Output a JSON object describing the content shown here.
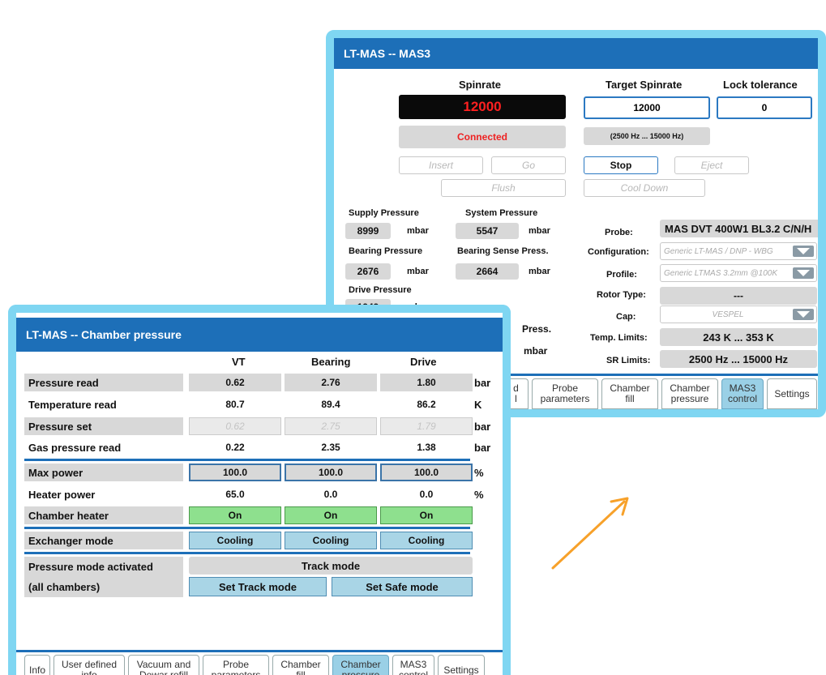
{
  "mas3": {
    "title": "LT-MAS -- MAS3",
    "spinrate_label": "Spinrate",
    "spinrate_value": "12000",
    "connection_status": "Connected",
    "target_label": "Target Spinrate",
    "target_value": "12000",
    "target_range": "(2500 Hz ... 15000 Hz)",
    "lock_label": "Lock tolerance",
    "lock_value": "0",
    "buttons": {
      "insert": "Insert",
      "go": "Go",
      "stop": "Stop",
      "eject": "Eject",
      "flush": "Flush",
      "cool_down": "Cool Down"
    },
    "pressures": {
      "supply_label": "Supply Pressure",
      "supply_value": "8999",
      "system_label": "System Pressure",
      "system_value": "5547",
      "bearing_label": "Bearing Pressure",
      "bearing_value": "2676",
      "bearing_sense_label": "Bearing Sense Press.",
      "bearing_sense_value": "2664",
      "drive_label": "Drive Pressure",
      "drive_value": "1949",
      "unit": "mbar",
      "partial_label": "Press.",
      "partial_unit": "mbar"
    },
    "probe": {
      "probe_label": "Probe:",
      "probe_value": "MAS DVT 400W1 BL3.2 C/N/H",
      "config_label": "Configuration:",
      "config_value": "Generic LT-MAS / DNP - WBG",
      "profile_label": "Profile:",
      "profile_value": "Generic LTMAS 3.2mm @100K",
      "rotor_label": "Rotor Type:",
      "rotor_value": "---",
      "cap_label": "Cap:",
      "cap_value": "VESPEL",
      "temp_label": "Temp. Limits:",
      "temp_value": "243 K ... 353 K",
      "sr_label": "SR Limits:",
      "sr_value": "2500 Hz ... 15000 Hz"
    },
    "tabs": [
      {
        "label": "d\nl"
      },
      {
        "label": "Probe\nparameters"
      },
      {
        "label": "Chamber\nfill"
      },
      {
        "label": "Chamber\npressure"
      },
      {
        "label": "MAS3\ncontrol",
        "active": true
      },
      {
        "label": "Settings"
      }
    ]
  },
  "chamber": {
    "title": "LT-MAS -- Chamber pressure",
    "columns": [
      "VT",
      "Bearing",
      "Drive"
    ],
    "rows": {
      "pressure_read": {
        "label": "Pressure read",
        "values": [
          "0.62",
          "2.76",
          "1.80"
        ],
        "unit": "bar"
      },
      "temperature_read": {
        "label": "Temperature read",
        "values": [
          "80.7",
          "89.4",
          "86.2"
        ],
        "unit": "K"
      },
      "pressure_set": {
        "label": "Pressure set",
        "values": [
          "0.62",
          "2.75",
          "1.79"
        ],
        "unit": "bar"
      },
      "gas_pressure_read": {
        "label": "Gas pressure read",
        "values": [
          "0.22",
          "2.35",
          "1.38"
        ],
        "unit": "bar"
      },
      "max_power": {
        "label": "Max power",
        "values": [
          "100.0",
          "100.0",
          "100.0"
        ],
        "unit": "%"
      },
      "heater_power": {
        "label": "Heater power",
        "values": [
          "65.0",
          "0.0",
          "0.0"
        ],
        "unit": "%"
      },
      "chamber_heater": {
        "label": "Chamber heater",
        "values": [
          "On",
          "On",
          "On"
        ]
      },
      "exchanger_mode": {
        "label": "Exchanger mode",
        "values": [
          "Cooling",
          "Cooling",
          "Cooling"
        ]
      }
    },
    "pressure_mode_label_1": "Pressure mode activated",
    "pressure_mode_label_2": "(all chambers)",
    "pressure_mode_value": "Track mode",
    "set_track_label": "Set Track mode",
    "set_safe_label": "Set Safe mode",
    "tabs": [
      {
        "label": "Info"
      },
      {
        "label": "User defined\ninfo"
      },
      {
        "label": "Vacuum and\nDewar refill"
      },
      {
        "label": "Probe\nparameters"
      },
      {
        "label": "Chamber\nfill"
      },
      {
        "label": "Chamber\npressure",
        "active": true
      },
      {
        "label": "MAS3\ncontrol"
      },
      {
        "label": "Settings"
      }
    ]
  },
  "colors": {
    "title_bar": "#1d6fb8",
    "frame": "#7fd6f2",
    "arrow": "#f7a12a",
    "spinrate_red": "#ff2020"
  }
}
